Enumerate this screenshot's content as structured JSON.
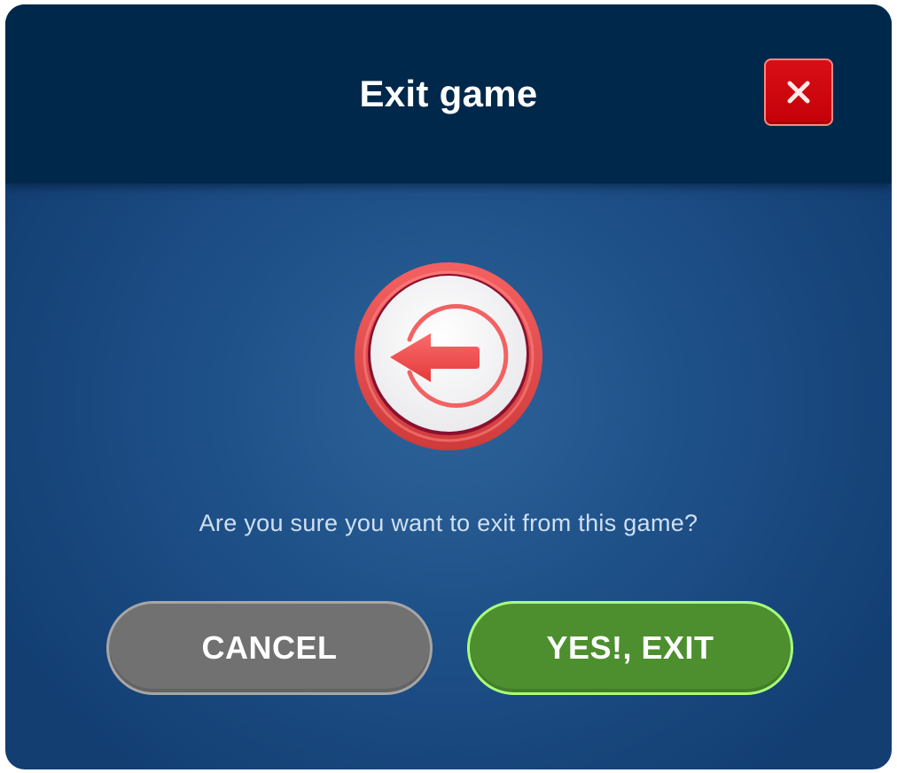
{
  "dialog": {
    "title": "Exit game",
    "message": "Are you sure you want to exit from this game?",
    "icons": {
      "close": "close-icon",
      "exit": "exit-arrow-icon"
    }
  },
  "buttons": {
    "cancel_label": "CANCEL",
    "confirm_label": "YES!, EXIT"
  },
  "colors": {
    "header": "#00284a",
    "body": "#1f5189",
    "close_button": "#d90f16",
    "cancel_button": "#717171",
    "confirm_button": "#4d8f2f",
    "confirm_border": "#a8ff7a",
    "exit_badge_ring": "#e94a4a"
  }
}
